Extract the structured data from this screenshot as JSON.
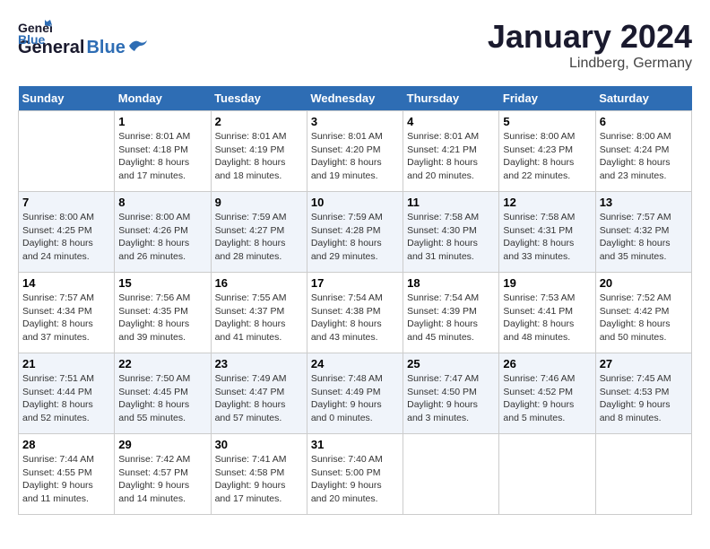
{
  "header": {
    "logo_line1": "General",
    "logo_line2": "Blue",
    "title": "January 2024",
    "subtitle": "Lindberg, Germany"
  },
  "weekdays": [
    "Sunday",
    "Monday",
    "Tuesday",
    "Wednesday",
    "Thursday",
    "Friday",
    "Saturday"
  ],
  "weeks": [
    [
      {
        "day": "",
        "sunrise": "",
        "sunset": "",
        "daylight": ""
      },
      {
        "day": "1",
        "sunrise": "Sunrise: 8:01 AM",
        "sunset": "Sunset: 4:18 PM",
        "daylight": "Daylight: 8 hours and 17 minutes."
      },
      {
        "day": "2",
        "sunrise": "Sunrise: 8:01 AM",
        "sunset": "Sunset: 4:19 PM",
        "daylight": "Daylight: 8 hours and 18 minutes."
      },
      {
        "day": "3",
        "sunrise": "Sunrise: 8:01 AM",
        "sunset": "Sunset: 4:20 PM",
        "daylight": "Daylight: 8 hours and 19 minutes."
      },
      {
        "day": "4",
        "sunrise": "Sunrise: 8:01 AM",
        "sunset": "Sunset: 4:21 PM",
        "daylight": "Daylight: 8 hours and 20 minutes."
      },
      {
        "day": "5",
        "sunrise": "Sunrise: 8:00 AM",
        "sunset": "Sunset: 4:23 PM",
        "daylight": "Daylight: 8 hours and 22 minutes."
      },
      {
        "day": "6",
        "sunrise": "Sunrise: 8:00 AM",
        "sunset": "Sunset: 4:24 PM",
        "daylight": "Daylight: 8 hours and 23 minutes."
      }
    ],
    [
      {
        "day": "7",
        "sunrise": "Sunrise: 8:00 AM",
        "sunset": "Sunset: 4:25 PM",
        "daylight": "Daylight: 8 hours and 24 minutes."
      },
      {
        "day": "8",
        "sunrise": "Sunrise: 8:00 AM",
        "sunset": "Sunset: 4:26 PM",
        "daylight": "Daylight: 8 hours and 26 minutes."
      },
      {
        "day": "9",
        "sunrise": "Sunrise: 7:59 AM",
        "sunset": "Sunset: 4:27 PM",
        "daylight": "Daylight: 8 hours and 28 minutes."
      },
      {
        "day": "10",
        "sunrise": "Sunrise: 7:59 AM",
        "sunset": "Sunset: 4:28 PM",
        "daylight": "Daylight: 8 hours and 29 minutes."
      },
      {
        "day": "11",
        "sunrise": "Sunrise: 7:58 AM",
        "sunset": "Sunset: 4:30 PM",
        "daylight": "Daylight: 8 hours and 31 minutes."
      },
      {
        "day": "12",
        "sunrise": "Sunrise: 7:58 AM",
        "sunset": "Sunset: 4:31 PM",
        "daylight": "Daylight: 8 hours and 33 minutes."
      },
      {
        "day": "13",
        "sunrise": "Sunrise: 7:57 AM",
        "sunset": "Sunset: 4:32 PM",
        "daylight": "Daylight: 8 hours and 35 minutes."
      }
    ],
    [
      {
        "day": "14",
        "sunrise": "Sunrise: 7:57 AM",
        "sunset": "Sunset: 4:34 PM",
        "daylight": "Daylight: 8 hours and 37 minutes."
      },
      {
        "day": "15",
        "sunrise": "Sunrise: 7:56 AM",
        "sunset": "Sunset: 4:35 PM",
        "daylight": "Daylight: 8 hours and 39 minutes."
      },
      {
        "day": "16",
        "sunrise": "Sunrise: 7:55 AM",
        "sunset": "Sunset: 4:37 PM",
        "daylight": "Daylight: 8 hours and 41 minutes."
      },
      {
        "day": "17",
        "sunrise": "Sunrise: 7:54 AM",
        "sunset": "Sunset: 4:38 PM",
        "daylight": "Daylight: 8 hours and 43 minutes."
      },
      {
        "day": "18",
        "sunrise": "Sunrise: 7:54 AM",
        "sunset": "Sunset: 4:39 PM",
        "daylight": "Daylight: 8 hours and 45 minutes."
      },
      {
        "day": "19",
        "sunrise": "Sunrise: 7:53 AM",
        "sunset": "Sunset: 4:41 PM",
        "daylight": "Daylight: 8 hours and 48 minutes."
      },
      {
        "day": "20",
        "sunrise": "Sunrise: 7:52 AM",
        "sunset": "Sunset: 4:42 PM",
        "daylight": "Daylight: 8 hours and 50 minutes."
      }
    ],
    [
      {
        "day": "21",
        "sunrise": "Sunrise: 7:51 AM",
        "sunset": "Sunset: 4:44 PM",
        "daylight": "Daylight: 8 hours and 52 minutes."
      },
      {
        "day": "22",
        "sunrise": "Sunrise: 7:50 AM",
        "sunset": "Sunset: 4:45 PM",
        "daylight": "Daylight: 8 hours and 55 minutes."
      },
      {
        "day": "23",
        "sunrise": "Sunrise: 7:49 AM",
        "sunset": "Sunset: 4:47 PM",
        "daylight": "Daylight: 8 hours and 57 minutes."
      },
      {
        "day": "24",
        "sunrise": "Sunrise: 7:48 AM",
        "sunset": "Sunset: 4:49 PM",
        "daylight": "Daylight: 9 hours and 0 minutes."
      },
      {
        "day": "25",
        "sunrise": "Sunrise: 7:47 AM",
        "sunset": "Sunset: 4:50 PM",
        "daylight": "Daylight: 9 hours and 3 minutes."
      },
      {
        "day": "26",
        "sunrise": "Sunrise: 7:46 AM",
        "sunset": "Sunset: 4:52 PM",
        "daylight": "Daylight: 9 hours and 5 minutes."
      },
      {
        "day": "27",
        "sunrise": "Sunrise: 7:45 AM",
        "sunset": "Sunset: 4:53 PM",
        "daylight": "Daylight: 9 hours and 8 minutes."
      }
    ],
    [
      {
        "day": "28",
        "sunrise": "Sunrise: 7:44 AM",
        "sunset": "Sunset: 4:55 PM",
        "daylight": "Daylight: 9 hours and 11 minutes."
      },
      {
        "day": "29",
        "sunrise": "Sunrise: 7:42 AM",
        "sunset": "Sunset: 4:57 PM",
        "daylight": "Daylight: 9 hours and 14 minutes."
      },
      {
        "day": "30",
        "sunrise": "Sunrise: 7:41 AM",
        "sunset": "Sunset: 4:58 PM",
        "daylight": "Daylight: 9 hours and 17 minutes."
      },
      {
        "day": "31",
        "sunrise": "Sunrise: 7:40 AM",
        "sunset": "Sunset: 5:00 PM",
        "daylight": "Daylight: 9 hours and 20 minutes."
      },
      {
        "day": "",
        "sunrise": "",
        "sunset": "",
        "daylight": ""
      },
      {
        "day": "",
        "sunrise": "",
        "sunset": "",
        "daylight": ""
      },
      {
        "day": "",
        "sunrise": "",
        "sunset": "",
        "daylight": ""
      }
    ]
  ]
}
